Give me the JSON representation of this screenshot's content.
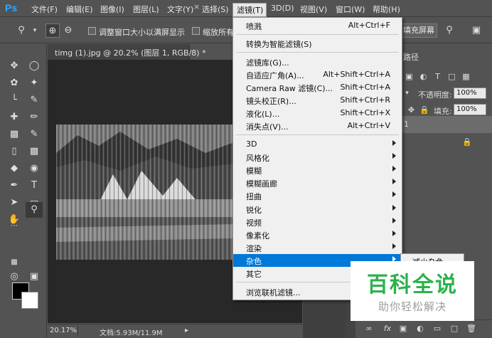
{
  "app": {
    "logo": "Ps"
  },
  "menubar": {
    "items": [
      "文件(F)",
      "编辑(E)",
      "图像(I)",
      "图层(L)",
      "文字(Y)",
      "选择(S)",
      "滤镜(T)",
      "3D(D)",
      "视图(V)",
      "窗口(W)",
      "帮助(H)"
    ],
    "active": "滤镜(T)"
  },
  "options": {
    "resize_windows_label": "调整窗口大小以满屏显示",
    "zoom_all_label": "缩放所有",
    "fill_screen_label": "填充屏幕"
  },
  "document": {
    "tab_title": "timg (1).jpg @ 20.2% (图层 1, RGB/8) *",
    "zoom": "20.17%",
    "info": "文档:5.93M/11.9M"
  },
  "layers_panel": {
    "tab_label": "路径",
    "opacity_label": "不透明度:",
    "opacity_value": "100%",
    "fill_label": "填充:",
    "fill_value": "100%",
    "layer_number": "1"
  },
  "filter_menu": {
    "items": [
      {
        "label": "喷溅",
        "shortcut": "Alt+Ctrl+F"
      },
      {
        "label": "转换为智能滤镜(S)",
        "shortcut": ""
      },
      {
        "label": "滤镜库(G)...",
        "shortcut": ""
      },
      {
        "label": "自适应广角(A)...",
        "shortcut": "Alt+Shift+Ctrl+A"
      },
      {
        "label": "Camera Raw 滤镜(C)...",
        "shortcut": "Shift+Ctrl+A"
      },
      {
        "label": "镜头校正(R)...",
        "shortcut": "Shift+Ctrl+R"
      },
      {
        "label": "液化(L)...",
        "shortcut": "Shift+Ctrl+X"
      },
      {
        "label": "消失点(V)...",
        "shortcut": "Alt+Ctrl+V"
      },
      {
        "label": "3D",
        "submenu": true
      },
      {
        "label": "风格化",
        "submenu": true
      },
      {
        "label": "模糊",
        "submenu": true
      },
      {
        "label": "模糊画廊",
        "submenu": true
      },
      {
        "label": "扭曲",
        "submenu": true
      },
      {
        "label": "锐化",
        "submenu": true
      },
      {
        "label": "视频",
        "submenu": true
      },
      {
        "label": "像素化",
        "submenu": true
      },
      {
        "label": "渲染",
        "submenu": true
      },
      {
        "label": "杂色",
        "submenu": true,
        "highlighted": true
      },
      {
        "label": "其它",
        "submenu": true
      },
      {
        "label": "浏览联机滤镜...",
        "shortcut": ""
      }
    ]
  },
  "noise_submenu": {
    "first_item": "减少杂色..."
  },
  "watermark": {
    "title": "百科全说",
    "subtitle": "助你轻松解决",
    "color": "#2bb24c"
  }
}
